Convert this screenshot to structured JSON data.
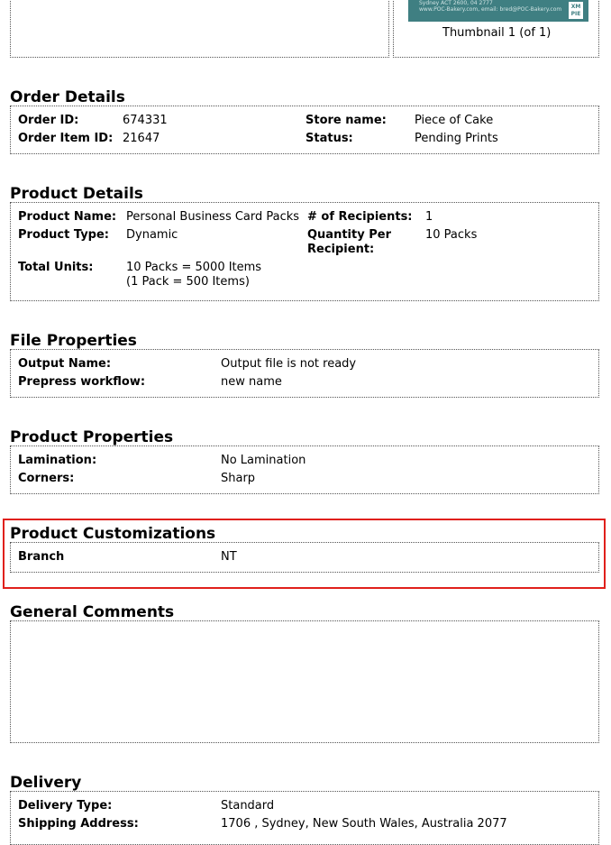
{
  "thumbnail": {
    "image_text_line1": "Sydney ACT 2600, 04 2777",
    "image_text_line2": "www.POC-Bakery.com, email: bred@POC-Bakery.com",
    "logo_text": "XM PIE",
    "caption": "Thumbnail 1 (of 1)"
  },
  "order_details": {
    "title": "Order Details",
    "order_id_label": "Order ID:",
    "order_id": "674331",
    "order_item_id_label": "Order Item ID:",
    "order_item_id": "21647",
    "store_name_label": "Store name:",
    "store_name": "Piece of Cake",
    "status_label": "Status:",
    "status": "Pending Prints"
  },
  "product_details": {
    "title": "Product Details",
    "product_name_label": "Product Name:",
    "product_name": "Personal Business Card Packs",
    "recipients_label": "# of Recipients:",
    "recipients": "1",
    "product_type_label": "Product Type:",
    "product_type": "Dynamic",
    "qty_label_line1": "Quantity Per",
    "qty_label_line2": "Recipient:",
    "qty": "10 Packs",
    "total_units_label": "Total Units:",
    "total_units_line1": "10 Packs = 5000 Items",
    "total_units_line2": "(1 Pack = 500 Items)"
  },
  "file_properties": {
    "title": "File Properties",
    "output_name_label": "Output Name:",
    "output_name": "Output file is not ready",
    "prepress_label": "Prepress workflow:",
    "prepress": "new name"
  },
  "product_properties": {
    "title": "Product Properties",
    "lamination_label": "Lamination:",
    "lamination": "No Lamination",
    "corners_label": "Corners:",
    "corners": "Sharp"
  },
  "product_customizations": {
    "title": "Product Customizations",
    "branch_label": "Branch",
    "branch": "NT"
  },
  "general_comments": {
    "title": "General Comments"
  },
  "delivery": {
    "title": "Delivery",
    "delivery_type_label": "Delivery Type:",
    "delivery_type": "Standard",
    "shipping_address_label": "Shipping Address:",
    "shipping_address": "1706 , Sydney, New South Wales, Australia 2077"
  },
  "colors": {
    "highlight": "#e0201b",
    "thumbnail_bg": "#3f7f82"
  }
}
